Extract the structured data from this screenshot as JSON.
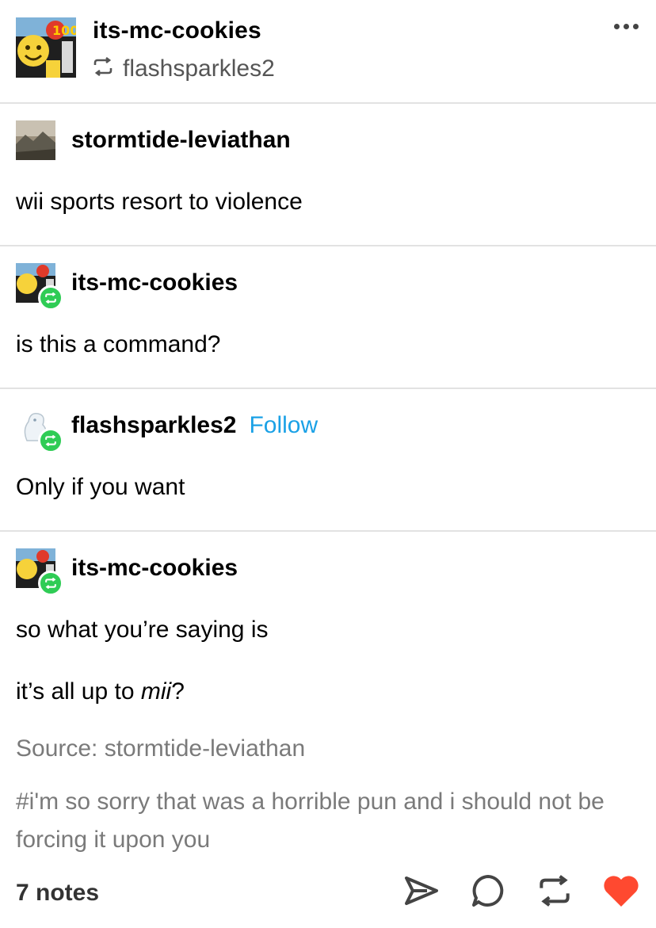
{
  "header": {
    "blog_name": "its-mc-cookies",
    "reblogged_from": "flashsparkles2",
    "more_icon": "more-horizontal-icon"
  },
  "thread": [
    {
      "username": "stormtide-leviathan",
      "avatar": "landscape-painting-avatar",
      "reblog_badge": false,
      "follow": "",
      "paragraphs": [
        "wii sports resort to violence"
      ]
    },
    {
      "username": "its-mc-cookies",
      "avatar": "emoji-collage-avatar",
      "reblog_badge": true,
      "follow": "",
      "paragraphs": [
        "is this a command?"
      ]
    },
    {
      "username": "flashsparkles2",
      "avatar": "white-creature-avatar",
      "reblog_badge": true,
      "follow": "Follow",
      "paragraphs": [
        "Only if you want"
      ]
    },
    {
      "username": "its-mc-cookies",
      "avatar": "emoji-collage-avatar",
      "reblog_badge": true,
      "follow": "",
      "paragraphs": [
        "so what you’re saying is",
        "it’s all up to ",
        "mii",
        "?"
      ]
    }
  ],
  "source": "Source: stormtide-leviathan",
  "tags": "#i'm so sorry that was a horrible pun and i should not be forcing it upon you",
  "footer": {
    "notes": "7 notes",
    "actions": [
      "share-icon",
      "reply-icon",
      "reblog-icon",
      "like-heart-icon"
    ]
  },
  "colors": {
    "follow_link": "#1aa1e6",
    "reblog_badge": "#2fcc55",
    "heart": "#ff4930",
    "muted_text": "#7a7a7a",
    "divider": "#e2e2e2"
  }
}
